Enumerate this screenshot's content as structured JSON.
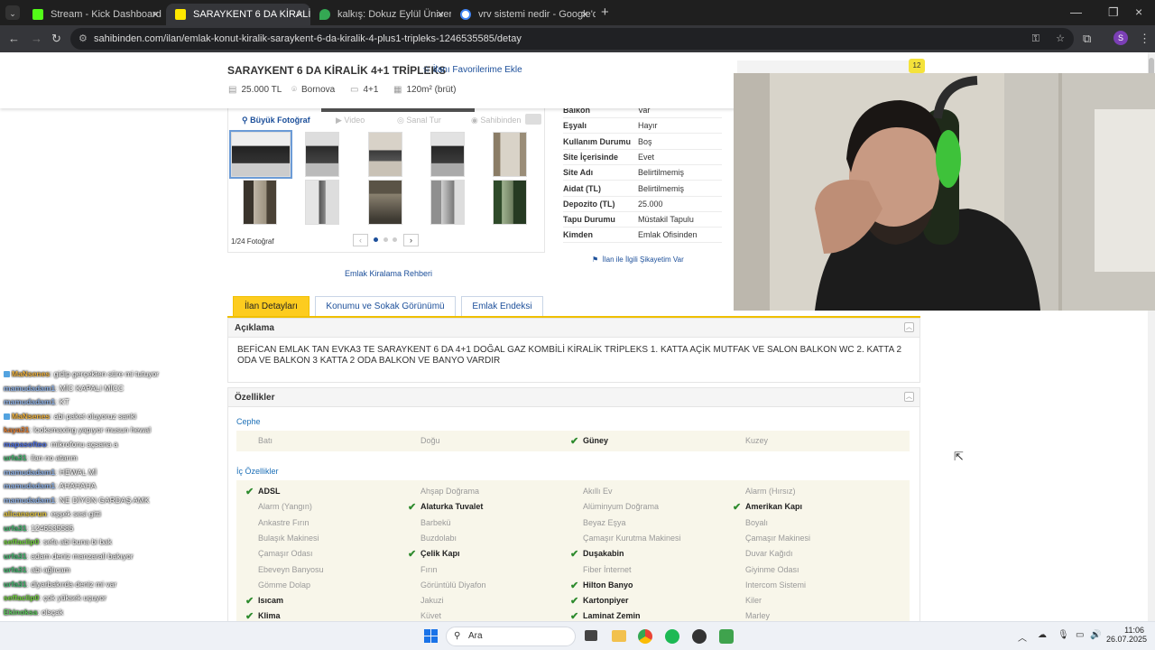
{
  "browser": {
    "tabs": [
      {
        "label": "Stream - Kick Dashboard",
        "color": "#53fc18"
      },
      {
        "label": "SARAYKENT 6 DA KİRALİK 4+1",
        "color": "#ffe800"
      },
      {
        "label": "kalkış: Dokuz Eylül Üniversitesi",
        "color": "#34a853"
      },
      {
        "label": "vrv sistemi nedir - Google'da A",
        "color": "#4285f4"
      }
    ],
    "url": "sahibinden.com/ilan/emlak-konut-kiralik-saraykent-6-da-kiralik-4-plus1-tripleks-1246535585/detay",
    "profile_initial": "S"
  },
  "listing": {
    "title": "SARAYKENT 6 DA KİRALİK 4+1 TRİPLEKS",
    "favorite_link": "İlanı Favorilerime Ekle",
    "price": "25.000 TL",
    "location": "Bornova",
    "rooms": "4+1",
    "area": "120m² (brüt)"
  },
  "gallery": {
    "buttons": [
      "Büyük Fotoğraf",
      "Video",
      "Sanal Tur",
      "Sahibinden"
    ],
    "counter": "1/24 Fotoğraf",
    "guide_link": "Emlak Kiralama Rehberi"
  },
  "details": [
    {
      "k": "Balkon",
      "v": "Var"
    },
    {
      "k": "Eşyalı",
      "v": "Hayır"
    },
    {
      "k": "Kullanım Durumu",
      "v": "Boş"
    },
    {
      "k": "Site İçerisinde",
      "v": "Evet"
    },
    {
      "k": "Site Adı",
      "v": "Belirtilmemiş"
    },
    {
      "k": "Aidat (TL)",
      "v": "Belirtilmemiş"
    },
    {
      "k": "Depozito (TL)",
      "v": "25.000"
    },
    {
      "k": "Tapu Durumu",
      "v": "Müstakil Tapulu"
    },
    {
      "k": "Kimden",
      "v": "Emlak Ofisinden"
    }
  ],
  "complaint_link": "İlan ile İlgili Şikayetim Var",
  "tabs": [
    "İlan Detayları",
    "Konumu ve Sokak Görünümü",
    "Emlak Endeksi"
  ],
  "description": {
    "heading": "Açıklama",
    "text": "BEFİCAN EMLAK TAN EVKA3 TE SARAYKENT 6 DA 4+1 DOĞAL GAZ KOMBİLİ KİRALİK TRİPLEKS 1. KATTA AÇİK MUTFAK VE SALON BALKON WC 2. KATTA 2 ODA VE BALKON 3 KATTA 2 ODA BALKON VE BANYO VARDIR"
  },
  "features": {
    "heading": "Özellikler",
    "cephe_label": "Cephe",
    "cephe": [
      {
        "label": "Batı",
        "on": false
      },
      {
        "label": "Doğu",
        "on": false
      },
      {
        "label": "Güney",
        "on": true
      },
      {
        "label": "Kuzey",
        "on": false
      }
    ],
    "ic_label": "İç Özellikler",
    "ic": [
      {
        "label": "ADSL",
        "on": true
      },
      {
        "label": "Ahşap Doğrama",
        "on": false
      },
      {
        "label": "Akıllı Ev",
        "on": false
      },
      {
        "label": "Alarm (Hırsız)",
        "on": false
      },
      {
        "label": "Alarm (Yangın)",
        "on": false
      },
      {
        "label": "Alaturka Tuvalet",
        "on": true
      },
      {
        "label": "Alüminyum Doğrama",
        "on": false
      },
      {
        "label": "Amerikan Kapı",
        "on": true
      },
      {
        "label": "Ankastre Fırın",
        "on": false
      },
      {
        "label": "Barbekü",
        "on": false
      },
      {
        "label": "Beyaz Eşya",
        "on": false
      },
      {
        "label": "Boyalı",
        "on": false
      },
      {
        "label": "Bulaşık Makinesi",
        "on": false
      },
      {
        "label": "Buzdolabı",
        "on": false
      },
      {
        "label": "Çamaşır Kurutma Makinesi",
        "on": false
      },
      {
        "label": "Çamaşır Makinesi",
        "on": false
      },
      {
        "label": "Çamaşır Odası",
        "on": false
      },
      {
        "label": "Çelik Kapı",
        "on": true
      },
      {
        "label": "Duşakabin",
        "on": true
      },
      {
        "label": "Duvar Kağıdı",
        "on": false
      },
      {
        "label": "Ebeveyn Banyosu",
        "on": false
      },
      {
        "label": "Fırın",
        "on": false
      },
      {
        "label": "Fiber İnternet",
        "on": false
      },
      {
        "label": "Giyinme Odası",
        "on": false
      },
      {
        "label": "Gömme Dolap",
        "on": false
      },
      {
        "label": "Görüntülü Diyafon",
        "on": false
      },
      {
        "label": "Hilton Banyo",
        "on": true
      },
      {
        "label": "Intercom Sistemi",
        "on": false
      },
      {
        "label": "Isıcam",
        "on": true
      },
      {
        "label": "Jakuzi",
        "on": false
      },
      {
        "label": "Kartonpiyer",
        "on": true
      },
      {
        "label": "Kiler",
        "on": false
      },
      {
        "label": "Klima",
        "on": true
      },
      {
        "label": "Küvet",
        "on": false
      },
      {
        "label": "Laminat Zemin",
        "on": true
      },
      {
        "label": "Marley",
        "on": false
      }
    ]
  },
  "stream_badge": "12",
  "chat": [
    {
      "user": "MaNsenes",
      "msg": ": gidip gerçekten süre mi tutuyor",
      "color": "#f0b23c",
      "badge": true
    },
    {
      "user": "mamudadam1",
      "msg": ": MİC KAPALI MİCC",
      "color": "#8fb3e8",
      "badge": false
    },
    {
      "user": "mamudadam1",
      "msg": ": KT",
      "color": "#8fb3e8",
      "badge": false
    },
    {
      "user": "MaNsenes",
      "msg": ": abi paket oluyoruz sanki",
      "color": "#f0b23c",
      "badge": true
    },
    {
      "user": "kaya31",
      "msg": ": looksmaxing yapıyor musun hewal",
      "color": "#e07b2e",
      "badge": false
    },
    {
      "user": "mapasofteo",
      "msg": ": mikrofonu açsana a",
      "color": "#4c6ee0",
      "badge": false
    },
    {
      "user": "urfa31",
      "msg": ": ilan no atarım",
      "color": "#3fb56b",
      "badge": false
    },
    {
      "user": "mamudadam1",
      "msg": ": HEWAL Mİ",
      "color": "#8fb3e8",
      "badge": false
    },
    {
      "user": "mamudadam1",
      "msg": ": AHAHAHA",
      "color": "#8fb3e8",
      "badge": false
    },
    {
      "user": "mamudadam1",
      "msg": ": NE DİYON GARDAŞ AMK",
      "color": "#8fb3e8",
      "badge": false
    },
    {
      "user": "alicansorun",
      "msg": ": eşşek sesi gitti",
      "color": "#e0c23a",
      "badge": false
    },
    {
      "user": "urfa31",
      "msg": ": 1246535585",
      "color": "#3fb56b",
      "badge": false
    },
    {
      "user": "seffaclip0",
      "msg": ": sefa abi buna bi bak",
      "color": "#6fd13a",
      "badge": false
    },
    {
      "user": "urfa31",
      "msg": ": adam deniz manzarali bakıyor",
      "color": "#3fb56b",
      "badge": false
    },
    {
      "user": "urfa31",
      "msg": ": abi ağlıcam",
      "color": "#3fb56b",
      "badge": false
    },
    {
      "user": "urfa31",
      "msg": ": diyarbakırda deniz mi var",
      "color": "#3fb56b",
      "badge": false
    },
    {
      "user": "seffaclip0",
      "msg": ": çok yüksek uçuyor",
      "color": "#6fd13a",
      "badge": false
    },
    {
      "user": "Ekinoksa",
      "msg": ": olsçak",
      "color": "#5ac95a",
      "badge": false
    },
    {
      "user": "MaNsenes",
      "msg": ": bunu da ekle",
      "color": "#f0b23c",
      "badge": true
    },
    {
      "user": "MaNsenes",
      "msg": ": boş ver",
      "color": "#f0b23c",
      "badge": true
    }
  ],
  "taskbar": {
    "search": "Ara",
    "time": "11:06",
    "date": "26.07.2025"
  }
}
